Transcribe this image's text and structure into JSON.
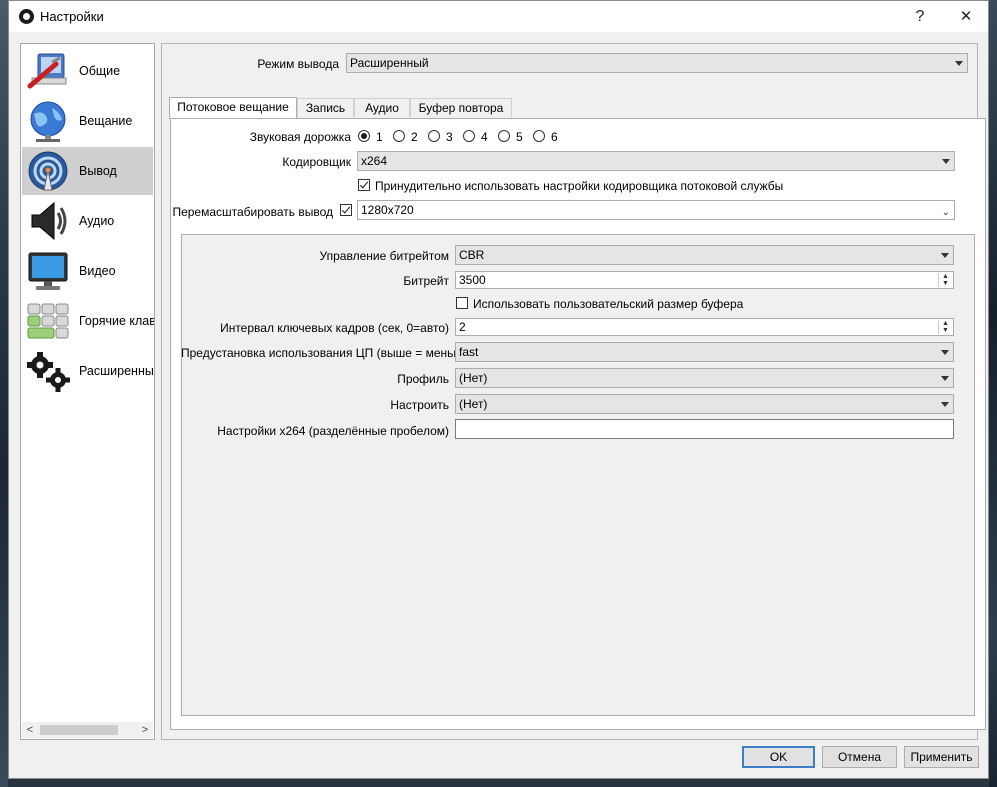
{
  "window": {
    "title": "Настройки",
    "help": "?",
    "close": "✕"
  },
  "sidebar": {
    "items": [
      {
        "label": "Общие",
        "icon": "general-settings-icon"
      },
      {
        "label": "Вещание",
        "icon": "stream-globe-icon"
      },
      {
        "label": "Вывод",
        "icon": "output-broadcast-icon",
        "selected": true
      },
      {
        "label": "Аудио",
        "icon": "speaker-icon"
      },
      {
        "label": "Видео",
        "icon": "monitor-icon"
      },
      {
        "label": "Горячие клав",
        "icon": "hotkeys-icon"
      },
      {
        "label": "Расширенны",
        "icon": "gears-icon"
      }
    ],
    "scroll_left": "<",
    "scroll_right": ">"
  },
  "output_mode": {
    "label": "Режим вывода",
    "value": "Расширенный"
  },
  "tabs": [
    {
      "label": "Потоковое вещание",
      "active": true
    },
    {
      "label": "Запись"
    },
    {
      "label": "Аудио"
    },
    {
      "label": "Буфер повтора"
    }
  ],
  "streaming": {
    "audio_track": {
      "label": "Звуковая дорожка",
      "options": [
        "1",
        "2",
        "3",
        "4",
        "5",
        "6"
      ],
      "selected": "1"
    },
    "encoder": {
      "label": "Кодировщик",
      "value": "x264"
    },
    "enforce": {
      "label": "Принудительно использовать настройки кодировщика потоковой службы",
      "checked": true
    },
    "rescale": {
      "label": "Перемасштабировать вывод",
      "checked": true,
      "value": "1280x720"
    }
  },
  "encoder_settings": {
    "rate_control": {
      "label": "Управление битрейтом",
      "value": "CBR"
    },
    "bitrate": {
      "label": "Битрейт",
      "value": "3500"
    },
    "custom_buffer": {
      "label": "Использовать пользовательский размер буфера",
      "checked": false
    },
    "keyframe": {
      "label": "Интервал ключевых кадров (сек, 0=авто)",
      "value": "2"
    },
    "cpu_preset": {
      "label": "Предустановка использования ЦП (выше = меньше)",
      "value": "fast"
    },
    "profile": {
      "label": "Профиль",
      "value": "(Нет)"
    },
    "tune": {
      "label": "Настроить",
      "value": "(Нет)"
    },
    "x264_opts": {
      "label": "Настройки x264 (разделённые пробелом)",
      "value": ""
    }
  },
  "buttons": {
    "ok": "OK",
    "cancel": "Отмена",
    "apply": "Применить"
  },
  "colors": {
    "selection": "#cfcfcf",
    "default_button_border": "#3c7fc8"
  }
}
